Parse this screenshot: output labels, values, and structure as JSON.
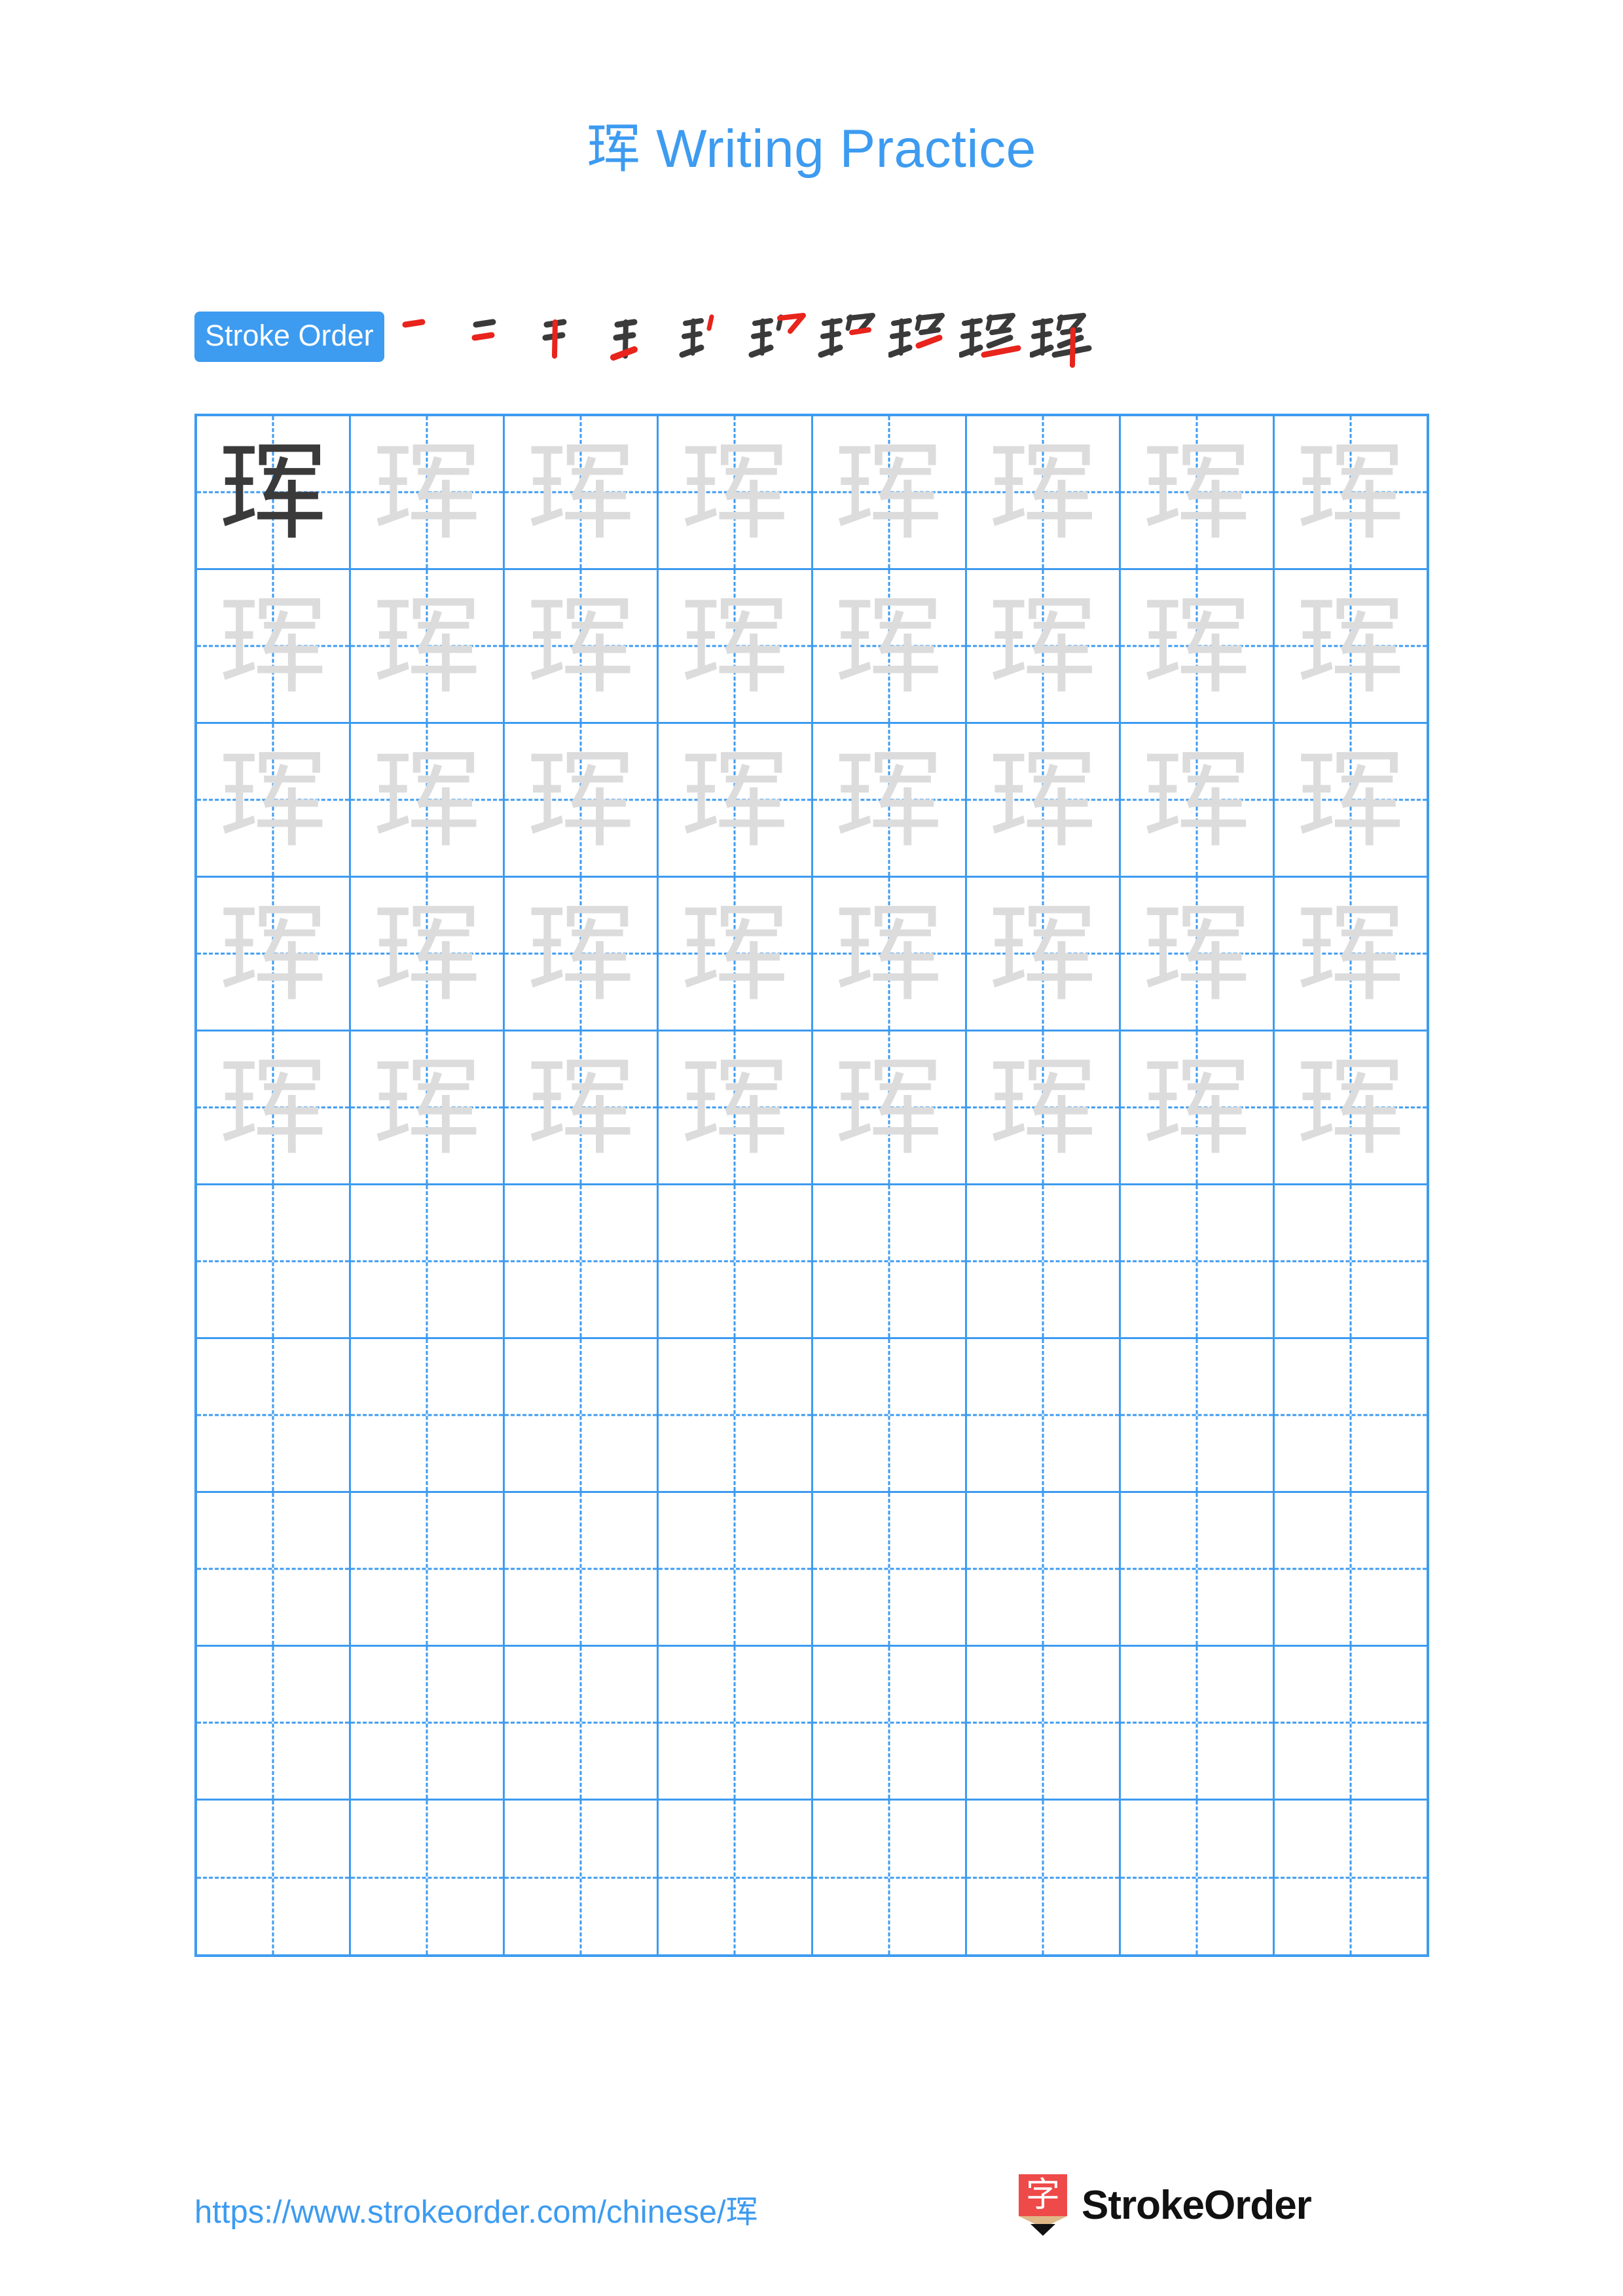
{
  "document": {
    "character": "珲",
    "title": "珲 Writing Practice",
    "title_character": "珲",
    "title_suffix": " Writing Practice"
  },
  "stroke_order": {
    "label": "Stroke Order",
    "total_strokes": 10,
    "steps": [
      {
        "index": 1,
        "new_stroke": "heng-dot (top-left short horizontal)"
      },
      {
        "index": 2,
        "new_stroke": "heng (second short horizontal)"
      },
      {
        "index": 3,
        "new_stroke": "shu (vertical)"
      },
      {
        "index": 4,
        "new_stroke": "ti (rising stroke)"
      },
      {
        "index": 5,
        "new_stroke": "pie (right component first short slash)"
      },
      {
        "index": 6,
        "new_stroke": "heng-zhe-gou (top cover of right component)"
      },
      {
        "index": 7,
        "new_stroke": "heng (inner short horizontal)"
      },
      {
        "index": 8,
        "new_stroke": "pie (inner slash)"
      },
      {
        "index": 9,
        "new_stroke": "heng (long bottom horizontal)"
      },
      {
        "index": 10,
        "new_stroke": "shu (final long vertical)"
      }
    ]
  },
  "practice_grid": {
    "columns": 8,
    "rows": 10,
    "filled_rows": 5,
    "empty_rows": 5,
    "grid_line_color": "#3d9bf0",
    "traced_character_color": "#dcdcdc",
    "model_character_color": "#3a3a3a",
    "cells": [
      [
        "dark",
        "light",
        "light",
        "light",
        "light",
        "light",
        "light",
        "light"
      ],
      [
        "light",
        "light",
        "light",
        "light",
        "light",
        "light",
        "light",
        "light"
      ],
      [
        "light",
        "light",
        "light",
        "light",
        "light",
        "light",
        "light",
        "light"
      ],
      [
        "light",
        "light",
        "light",
        "light",
        "light",
        "light",
        "light",
        "light"
      ],
      [
        "light",
        "light",
        "light",
        "light",
        "light",
        "light",
        "light",
        "light"
      ],
      [
        "empty",
        "empty",
        "empty",
        "empty",
        "empty",
        "empty",
        "empty",
        "empty"
      ],
      [
        "empty",
        "empty",
        "empty",
        "empty",
        "empty",
        "empty",
        "empty",
        "empty"
      ],
      [
        "empty",
        "empty",
        "empty",
        "empty",
        "empty",
        "empty",
        "empty",
        "empty"
      ],
      [
        "empty",
        "empty",
        "empty",
        "empty",
        "empty",
        "empty",
        "empty",
        "empty"
      ],
      [
        "empty",
        "empty",
        "empty",
        "empty",
        "empty",
        "empty",
        "empty",
        "empty"
      ]
    ]
  },
  "footer": {
    "url": "https://www.strokeorder.com/chinese/珲",
    "brand_name": "StrokeOrder",
    "brand_mark_character": "字"
  },
  "colors": {
    "accent_blue": "#3d9bf0",
    "stroke_new_red": "#e8241c",
    "stroke_done_black": "#3a3a3a",
    "brand_red": "#ef4a4a",
    "brand_wood": "#deb887"
  }
}
